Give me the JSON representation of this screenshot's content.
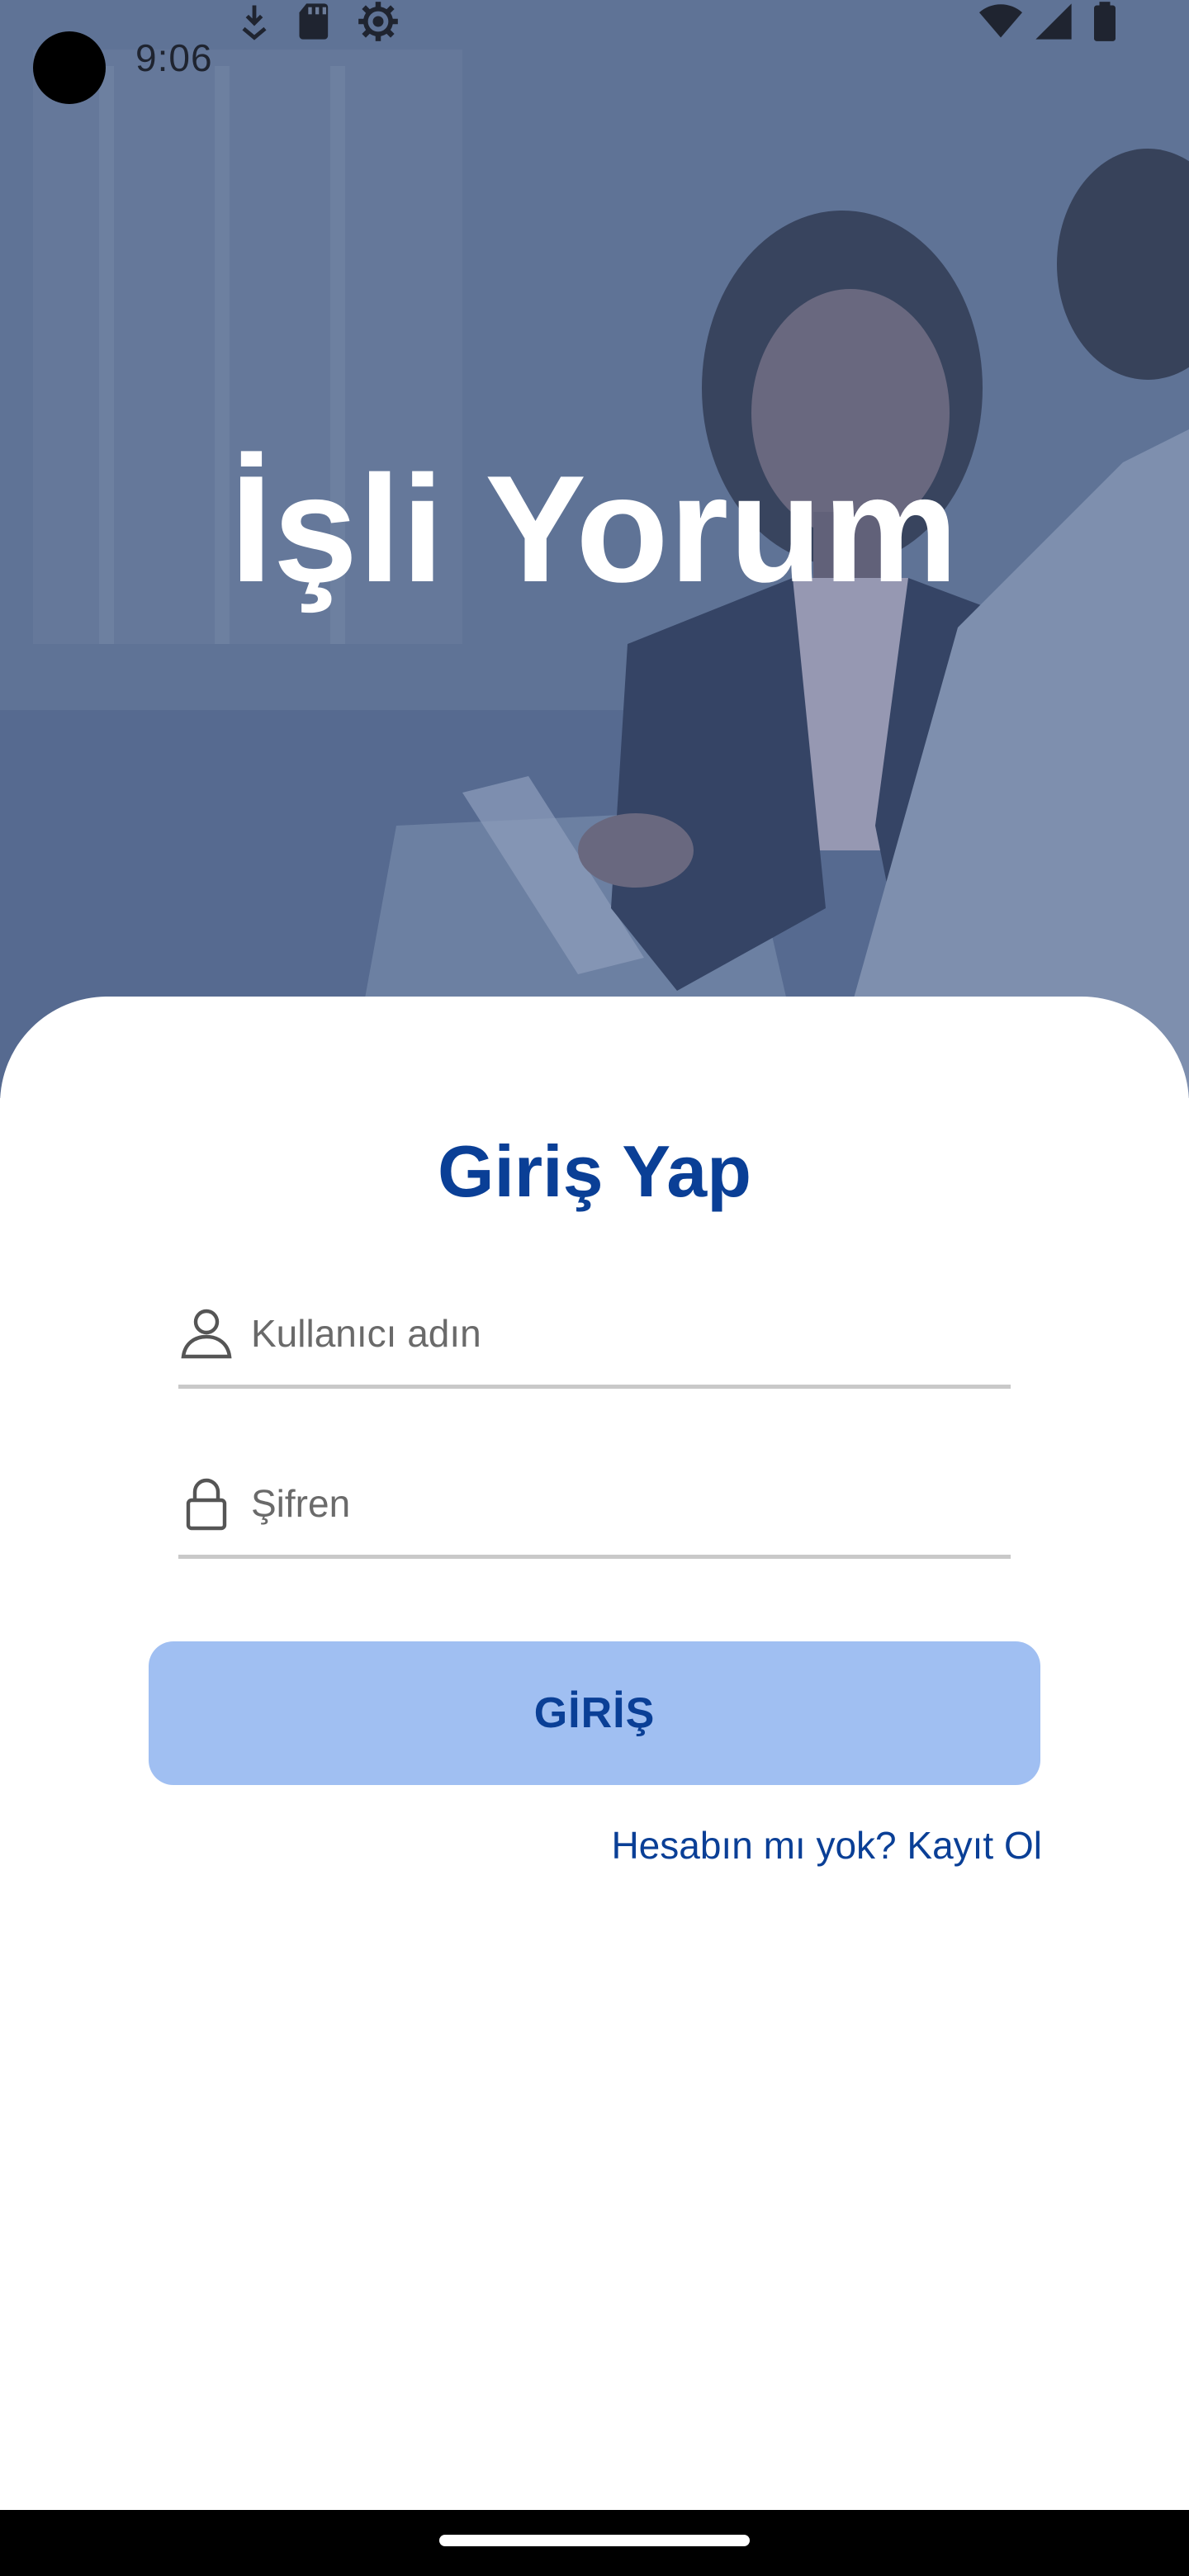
{
  "status_bar": {
    "time": "9:06",
    "left_icons": [
      "download-arrow-icon",
      "sd-card-icon",
      "settings-gear-icon"
    ],
    "right_icons": [
      "wifi-icon",
      "cellular-signal-icon",
      "battery-icon"
    ]
  },
  "hero": {
    "title": "İşli Yorum",
    "overlay_color": "#5b6f95"
  },
  "login": {
    "title": "Giriş Yap",
    "username_placeholder": "Kullanıcı adın",
    "password_placeholder": "Şifren",
    "submit_label": "GİRİŞ",
    "register_link": "Hesabın mı yok? Kayıt Ol"
  },
  "colors": {
    "brand": "#0a3f96",
    "button_bg": "#a0bff2",
    "field_underline": "#c9c9c9"
  }
}
